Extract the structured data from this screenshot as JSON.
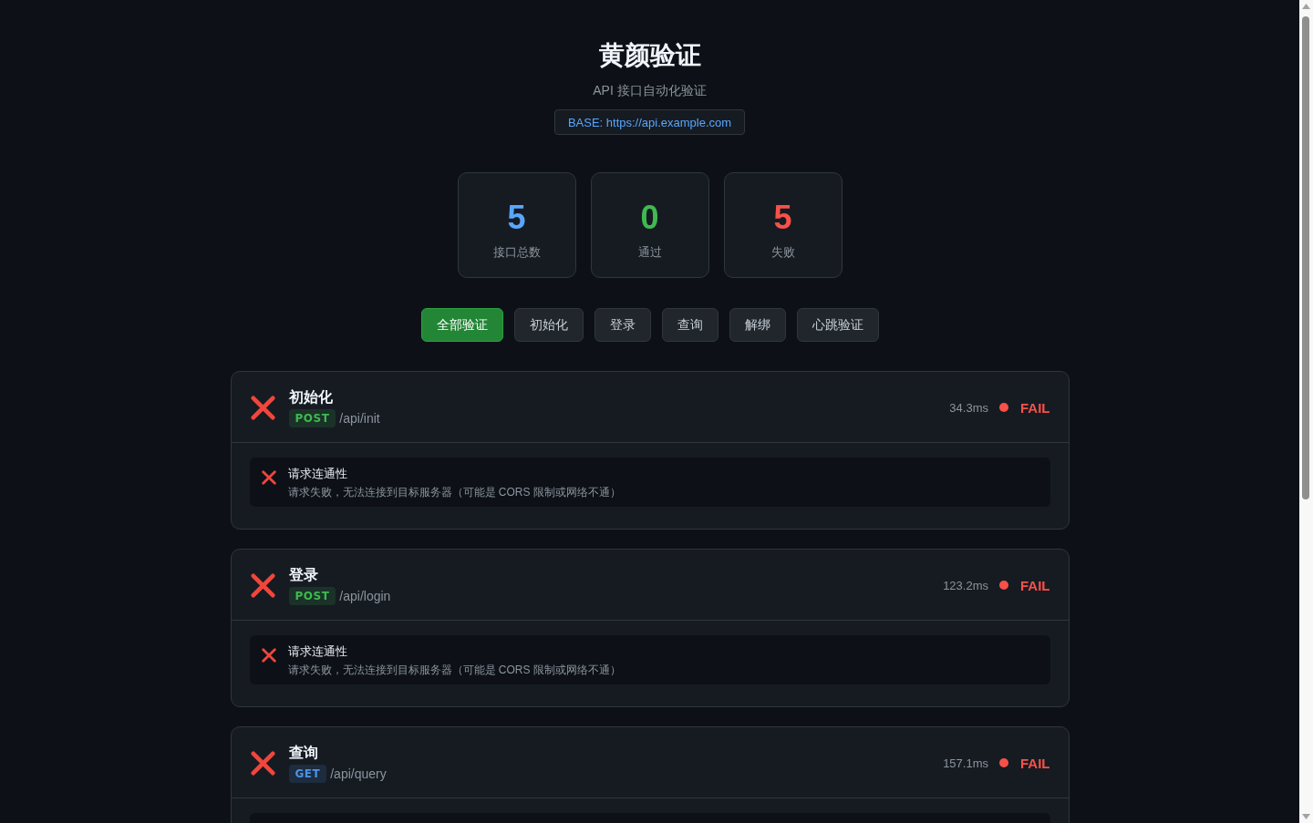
{
  "header": {
    "title": "黄颜验证",
    "subtitle": "API 接口自动化验证",
    "base_url": "BASE: https://api.example.com"
  },
  "stats": [
    {
      "value": "5",
      "label": "接口总数",
      "color": "#58a6ff"
    },
    {
      "value": "0",
      "label": "通过",
      "color": "#3fb950"
    },
    {
      "value": "5",
      "label": "失败",
      "color": "#f85149"
    }
  ],
  "filters": [
    {
      "label": "全部验证",
      "selected": true
    },
    {
      "label": "初始化",
      "selected": false
    },
    {
      "label": "登录",
      "selected": false
    },
    {
      "label": "查询",
      "selected": false
    },
    {
      "label": "解绑",
      "selected": false
    },
    {
      "label": "心跳验证",
      "selected": false
    }
  ],
  "endpoints": [
    {
      "name": "初始化",
      "method": {
        "label": "POST",
        "color": "#3fb950"
      },
      "path": "/api/init",
      "duration": "34.3ms",
      "passed": false,
      "result": "FAIL",
      "checks": [
        {
          "passed": false,
          "title": "请求连通性",
          "message": "请求失败，无法连接到目标服务器（可能是 CORS 限制或网络不通）"
        }
      ]
    },
    {
      "name": "登录",
      "method": {
        "label": "POST",
        "color": "#3fb950"
      },
      "path": "/api/login",
      "duration": "123.2ms",
      "passed": false,
      "result": "FAIL",
      "checks": [
        {
          "passed": false,
          "title": "请求连通性",
          "message": "请求失败，无法连接到目标服务器（可能是 CORS 限制或网络不通）"
        }
      ]
    },
    {
      "name": "查询",
      "method": {
        "label": "GET",
        "color": "#4c93e4"
      },
      "path": "/api/query",
      "duration": "157.1ms",
      "passed": false,
      "result": "FAIL"
    }
  ]
}
